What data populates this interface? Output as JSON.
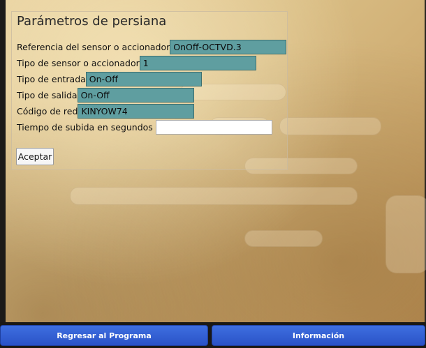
{
  "form": {
    "title": "Parámetros de persiana",
    "fields": [
      {
        "label": "Referencia del sensor o accionador",
        "value": "OnOff-OCTVD.3"
      },
      {
        "label": "Tipo de sensor o accionador",
        "value": "1"
      },
      {
        "label": "Tipo de entrada",
        "value": "On-Off"
      },
      {
        "label": "Tipo de salida",
        "value": "On-Off"
      },
      {
        "label": "Código de red",
        "value": "KINYOW74"
      },
      {
        "label": "Tiempo de subida en segundos",
        "value": ""
      }
    ],
    "accept_label": "Aceptar"
  },
  "footer": {
    "back_label": "Regresar al Programa",
    "info_label": "Información"
  },
  "colors": {
    "field_fill": "#5f9ea0",
    "nav_button": "#2f5bd3"
  }
}
